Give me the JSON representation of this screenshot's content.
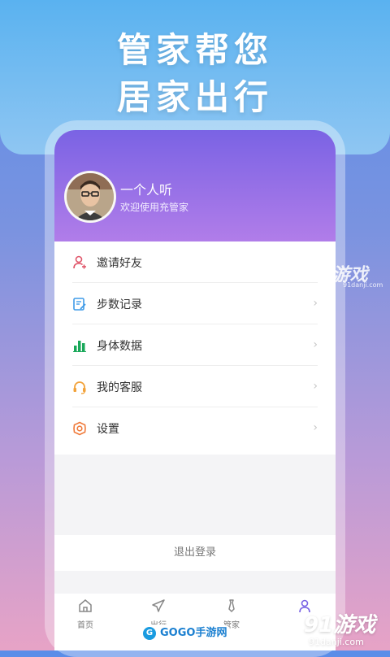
{
  "banner": {
    "line1": "管家帮您",
    "line2": "居家出行"
  },
  "profile": {
    "name": "一个人听",
    "subtitle": "欢迎使用充管家"
  },
  "menu": [
    {
      "label": "邀请好友",
      "icon": "user-plus-icon",
      "chevron": false
    },
    {
      "label": "步数记录",
      "icon": "notepad-icon",
      "chevron": true
    },
    {
      "label": "身体数据",
      "icon": "bar-chart-icon",
      "chevron": true
    },
    {
      "label": "我的客服",
      "icon": "headset-icon",
      "chevron": true
    },
    {
      "label": "设置",
      "icon": "gear-icon",
      "chevron": true
    }
  ],
  "chevron": "›",
  "logout": "退出登录",
  "tabs": [
    {
      "label": "首页",
      "icon": "home-icon"
    },
    {
      "label": "出行",
      "icon": "plane-icon"
    },
    {
      "label": "管家",
      "icon": "tie-icon"
    },
    {
      "label": "",
      "icon": "person-icon"
    }
  ],
  "watermarks": {
    "side_logo": "91游戏",
    "side_url": "91danji.com",
    "bottom_logo": "91游戏",
    "bottom_url": "91danji.com",
    "gogo": "GOGO手游网"
  },
  "colors": {
    "header_start": "#7a63e4",
    "header_end": "#b17de9",
    "bg_top": "#5ab2f0"
  }
}
